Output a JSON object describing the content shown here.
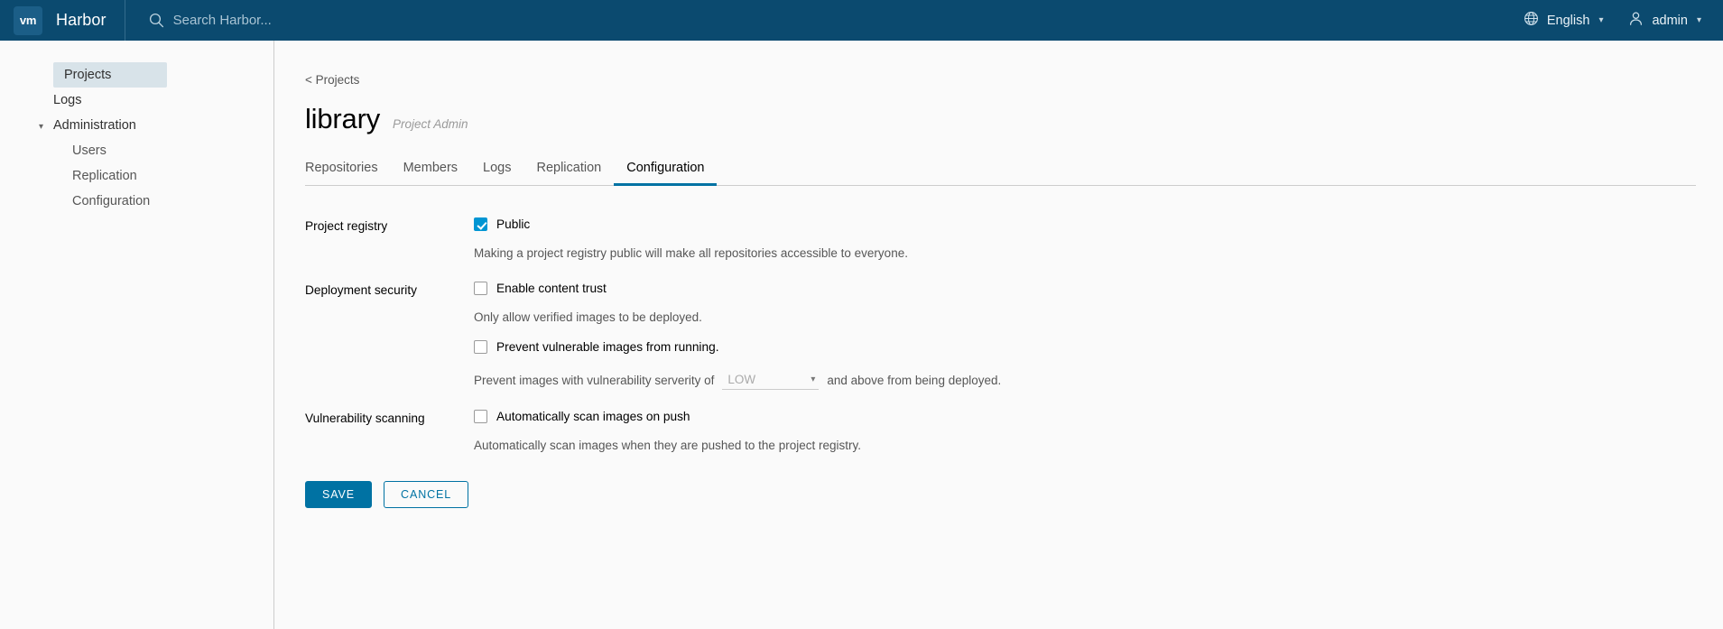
{
  "header": {
    "logo_text": "vm",
    "brand": "Harbor",
    "search_placeholder": "Search Harbor...",
    "search_value": "",
    "language": "English",
    "user": "admin"
  },
  "sidebar": {
    "items": [
      {
        "label": "Projects",
        "type": "item",
        "active": true
      },
      {
        "label": "Logs",
        "type": "item",
        "active": false
      },
      {
        "label": "Administration",
        "type": "group",
        "active": false
      },
      {
        "label": "Users",
        "type": "sub",
        "active": false
      },
      {
        "label": "Replication",
        "type": "sub",
        "active": false
      },
      {
        "label": "Configuration",
        "type": "sub",
        "active": false
      }
    ]
  },
  "main": {
    "breadcrumb": "< Projects",
    "project_name": "library",
    "project_role": "Project Admin",
    "tabs": [
      {
        "label": "Repositories",
        "active": false
      },
      {
        "label": "Members",
        "active": false
      },
      {
        "label": "Logs",
        "active": false
      },
      {
        "label": "Replication",
        "active": false
      },
      {
        "label": "Configuration",
        "active": true
      }
    ],
    "sections": {
      "project_registry": {
        "label": "Project registry",
        "public_label": "Public",
        "public_checked": true,
        "helper": "Making a project registry public will make all repositories accessible to everyone."
      },
      "deployment_security": {
        "label": "Deployment security",
        "content_trust_label": "Enable content trust",
        "content_trust_checked": false,
        "content_trust_helper": "Only allow verified images to be deployed.",
        "prevent_vulnerable_label": "Prevent vulnerable images from running.",
        "prevent_vulnerable_checked": false,
        "severity_prefix": "Prevent images with vulnerability serverity of",
        "severity_value": "LOW",
        "severity_suffix": "and above from being deployed."
      },
      "vulnerability_scanning": {
        "label": "Vulnerability scanning",
        "auto_scan_label": "Automatically scan images on push",
        "auto_scan_checked": false,
        "helper": "Automatically scan images when they are pushed to the project registry."
      }
    },
    "buttons": {
      "save": "SAVE",
      "cancel": "CANCEL"
    }
  },
  "colors": {
    "header_bg": "#0b4a6f",
    "accent": "#0072a3",
    "checkbox_checked": "#0095d3",
    "sidebar_active_bg": "#d8e3e9"
  }
}
